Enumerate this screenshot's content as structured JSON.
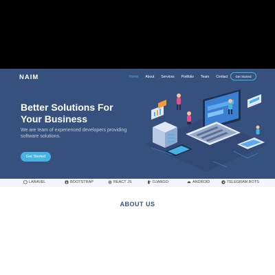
{
  "header": {
    "brand": "NAIM",
    "nav": [
      "Home",
      "About",
      "Services",
      "Portfolio",
      "Team",
      "Contact"
    ],
    "cta": "Get Started"
  },
  "hero": {
    "title_line1": "Better Solutions For",
    "title_line2": "Your Business",
    "subtitle_line1": "We are team of experienced developers providing",
    "subtitle_line2": "software solutions.",
    "button": "Get Started"
  },
  "clients": {
    "items": [
      {
        "label": "LARAVEL",
        "icon": "laravel-icon"
      },
      {
        "label": "BOOTSTRAP",
        "icon": "bootstrap-icon"
      },
      {
        "label": "REACT JS",
        "icon": "react-icon"
      },
      {
        "label": "DJANGO",
        "icon": "django-icon"
      },
      {
        "label": "ANDROID",
        "icon": "android-icon"
      },
      {
        "label": "TELEGRAM BOTS",
        "icon": "telegram-icon"
      }
    ]
  },
  "about": {
    "title": "ABOUT US"
  },
  "colors": {
    "hero_bg": "#37517e",
    "accent": "#47b2e4",
    "clients_bg": "#f3f5fa"
  }
}
